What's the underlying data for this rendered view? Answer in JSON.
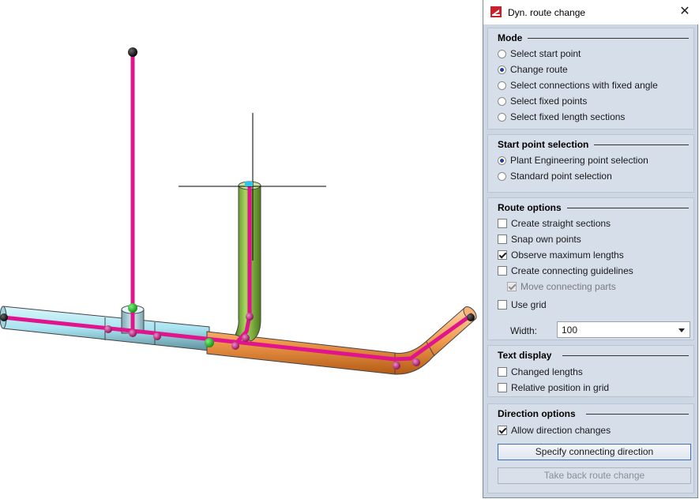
{
  "dialog": {
    "title": "Dyn. route change",
    "close_glyph": "✕",
    "title_icon": "app-logo-icon",
    "accent_color": "#cc1f2a"
  },
  "mode": {
    "heading": "Mode",
    "options": [
      "Select start point",
      "Change route",
      "Select connections with fixed angle",
      "Select fixed points",
      "Select fixed length sections"
    ],
    "selected": "Change route"
  },
  "start_point": {
    "heading": "Start point selection",
    "options": [
      "Plant Engineering point selection",
      "Standard point selection"
    ],
    "selected": "Plant Engineering point selection"
  },
  "route_options": {
    "heading": "Route options",
    "create_straight_sections": "Create straight sections",
    "snap_own_points": "Snap own points",
    "observe_maximum_lengths": "Observe maximum lengths",
    "create_connecting_guidelines": "Create connecting guidelines",
    "move_connecting_parts": "Move connecting parts",
    "use_grid": "Use grid",
    "width_label": "Width:",
    "width_value": "100"
  },
  "text_display": {
    "heading": "Text display",
    "changed_lengths": "Changed lengths",
    "relative_position": "Relative position in grid"
  },
  "direction_options": {
    "heading": "Direction options",
    "allow_direction_changes": "Allow direction changes",
    "specify_button": "Specify connecting direction",
    "take_back_button": "Take back route change"
  },
  "colors": {
    "route_line": "#e0148c",
    "pipe_cyan": "#a9e3f1",
    "pipe_green": "#7fb43a",
    "pipe_orange": "#f09a4e",
    "point_dark": "#161616",
    "point_green": "#22b322",
    "point_magenta": "#b51370"
  }
}
